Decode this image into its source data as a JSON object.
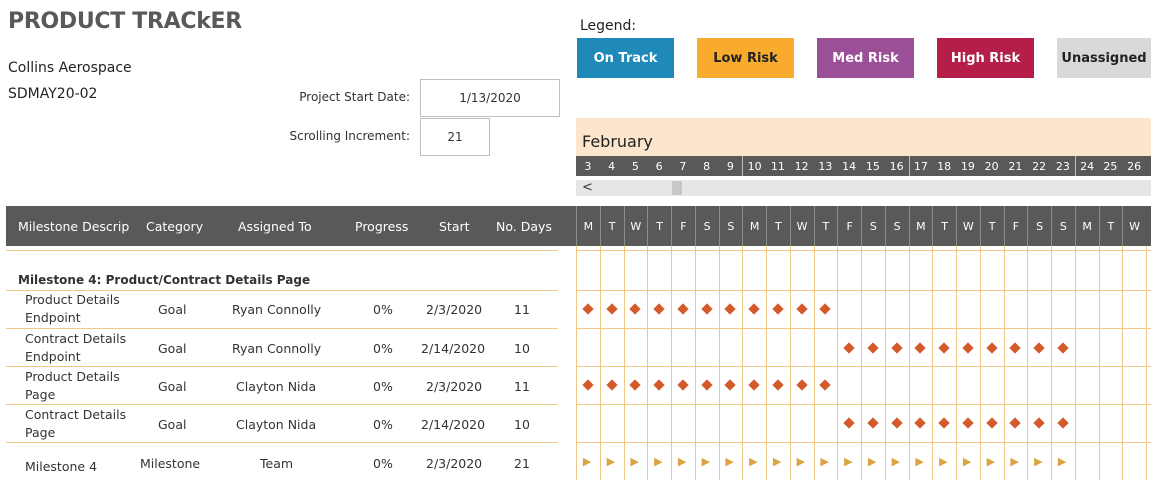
{
  "header": {
    "title": "PRODUCT TRACkER",
    "company": "Collins Aerospace",
    "team": "SDMAY20-02",
    "start_date_label": "Project Start Date:",
    "start_date_value": "1/13/2020",
    "scroll_label": "Scrolling Increment:",
    "scroll_value": "21"
  },
  "legend": {
    "title": "Legend:",
    "items": [
      {
        "label": "On Track",
        "bg": "#1f8ab8",
        "fg": "#ffffff"
      },
      {
        "label": "Low Risk",
        "bg": "#f9ab2e",
        "fg": "#222222"
      },
      {
        "label": "Med Risk",
        "bg": "#9b4f96",
        "fg": "#ffffff"
      },
      {
        "label": "High Risk",
        "bg": "#b41e48",
        "fg": "#ffffff"
      },
      {
        "label": "Unassigned",
        "bg": "#d9d9d9",
        "fg": "#222222"
      }
    ]
  },
  "calendar": {
    "month": "February",
    "day_numbers": [
      "3",
      "4",
      "5",
      "6",
      "7",
      "8",
      "9",
      "10",
      "11",
      "12",
      "13",
      "14",
      "15",
      "16",
      "17",
      "18",
      "19",
      "20",
      "21",
      "22",
      "23",
      "24",
      "25",
      "26"
    ],
    "weekdays": [
      "M",
      "T",
      "W",
      "T",
      "F",
      "S",
      "S",
      "M",
      "T",
      "W",
      "T",
      "F",
      "S",
      "S",
      "M",
      "T",
      "W",
      "T",
      "F",
      "S",
      "S",
      "M",
      "T",
      "W"
    ],
    "scroll_arrow": "<"
  },
  "table": {
    "columns": [
      "Milestone Descrip",
      "Category",
      "Assigned To",
      "Progress",
      "Start",
      "No. Days"
    ],
    "section_label": "Milestone 4: Product/Contract Details Page",
    "rows": [
      {
        "desc1": "Product Details",
        "desc2": "Endpoint",
        "category": "Goal",
        "assigned": "Ryan Connolly",
        "progress": "0%",
        "start": "2/3/2020",
        "days": "11",
        "start_idx": 0,
        "length": 11,
        "marker": "diamond"
      },
      {
        "desc1": "Contract Details",
        "desc2": "Endpoint",
        "category": "Goal",
        "assigned": "Ryan Connolly",
        "progress": "0%",
        "start": "2/14/2020",
        "days": "10",
        "start_idx": 11,
        "length": 10,
        "marker": "diamond"
      },
      {
        "desc1": "Product Details",
        "desc2": "Page",
        "category": "Goal",
        "assigned": "Clayton Nida",
        "progress": "0%",
        "start": "2/3/2020",
        "days": "11",
        "start_idx": 0,
        "length": 11,
        "marker": "diamond"
      },
      {
        "desc1": "Contract Details",
        "desc2": "Page",
        "category": "Goal",
        "assigned": "Clayton Nida",
        "progress": "0%",
        "start": "2/14/2020",
        "days": "10",
        "start_idx": 11,
        "length": 10,
        "marker": "diamond"
      },
      {
        "desc1": "",
        "desc2": "Milestone 4",
        "category": "Milestone",
        "assigned": "Team",
        "progress": "0%",
        "start": "2/3/2020",
        "days": "21",
        "start_idx": 0,
        "length": 21,
        "marker": "flag"
      }
    ]
  },
  "colors": {
    "header_gray": "#595959",
    "grid_orange": "#f0c987",
    "task_marker": "#d35a2a",
    "milestone_flag": "#d9a441"
  }
}
